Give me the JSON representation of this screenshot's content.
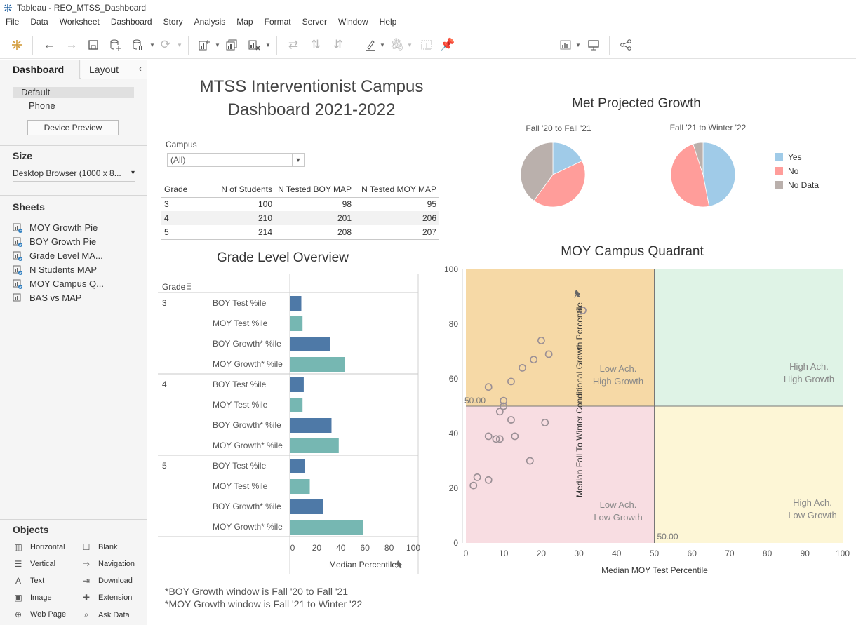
{
  "window": {
    "title": "Tableau - REO_MTSS_Dashboard"
  },
  "menu": [
    "File",
    "Data",
    "Worksheet",
    "Dashboard",
    "Story",
    "Analysis",
    "Map",
    "Format",
    "Server",
    "Window",
    "Help"
  ],
  "sidebar": {
    "tab_dashboard": "Dashboard",
    "tab_layout": "Layout",
    "device_default": "Default",
    "device_phone": "Phone",
    "device_preview": "Device Preview",
    "size_header": "Size",
    "size_value": "Desktop Browser (1000 x 8...",
    "sheets_header": "Sheets",
    "sheets": [
      "MOY Growth Pie",
      "BOY Growth Pie",
      "Grade Level MA...",
      "N Students MAP",
      "MOY Campus Q...",
      "BAS vs MAP"
    ],
    "objects_header": "Objects",
    "objects": [
      "Horizontal",
      "Blank",
      "Vertical",
      "Navigation",
      "Text",
      "Download",
      "Image",
      "Extension",
      "Web Page",
      "Ask Data"
    ]
  },
  "dashboard": {
    "title_line1": "MTSS Interventionist Campus",
    "title_line2": "Dashboard 2021-2022",
    "campus_label": "Campus",
    "campus_value": "(All)",
    "table": {
      "headers": [
        "Grade",
        "N of Students",
        "N Tested BOY MAP",
        "N Tested MOY MAP"
      ],
      "rows": [
        [
          "3",
          "100",
          "98",
          "95"
        ],
        [
          "4",
          "210",
          "201",
          "206"
        ],
        [
          "5",
          "214",
          "208",
          "207"
        ]
      ]
    },
    "growth_title": "Met Projected Growth",
    "pie1_label": "Fall '20 to Fall '21",
    "pie2_label": "Fall '21 to Winter '22",
    "legend": [
      {
        "label": "Yes",
        "color": "#a0cbe8"
      },
      {
        "label": "No",
        "color": "#ff9d9a"
      },
      {
        "label": "No Data",
        "color": "#bab0ac"
      }
    ],
    "grade_overview_title": "Grade Level Overview",
    "grade_col_header": "Grade",
    "bar_axis_title": "Median Percentile",
    "quadrant_title": "MOY Campus Quadrant",
    "quadrant_x_title": "Median MOY Test Percentile",
    "quadrant_y_title": "Median Fall To Winter Conditional Growth Percentile",
    "quadrant_labels": {
      "tl": [
        "Low Ach.",
        "High Growth"
      ],
      "tr": [
        "High Ach.",
        "High Growth"
      ],
      "bl": [
        "Low Ach.",
        "Low Growth"
      ],
      "br": [
        "High Ach.",
        "Low Growth"
      ]
    },
    "ref_line_label_y": "50.00",
    "ref_line_label_x": "50.00",
    "footnote1": "*BOY Growth window is Fall '20 to Fall '21",
    "footnote2": "*MOY Growth window is Fall '21 to Winter '22"
  },
  "chart_data": [
    {
      "type": "pie",
      "title": "Fall '20 to Fall '21",
      "categories": [
        "Yes",
        "No",
        "No Data"
      ],
      "values": [
        18,
        42,
        40
      ]
    },
    {
      "type": "pie",
      "title": "Fall '21 to Winter '22",
      "categories": [
        "Yes",
        "No",
        "No Data"
      ],
      "values": [
        47,
        48,
        5
      ]
    },
    {
      "type": "bar",
      "title": "Grade Level Overview",
      "xlabel": "Median Percentile",
      "xlim": [
        0,
        100
      ],
      "ticks": [
        0,
        20,
        40,
        60,
        80,
        100
      ],
      "groups": [
        {
          "grade": "3",
          "bars": [
            {
              "label": "BOY Test %ile",
              "value": 9
            },
            {
              "label": "MOY Test %ile",
              "value": 10
            },
            {
              "label": "BOY Growth* %ile",
              "value": 33
            },
            {
              "label": "MOY Growth* %ile",
              "value": 45
            }
          ]
        },
        {
          "grade": "4",
          "bars": [
            {
              "label": "BOY Test %ile",
              "value": 11
            },
            {
              "label": "MOY Test %ile",
              "value": 10
            },
            {
              "label": "BOY Growth* %ile",
              "value": 34
            },
            {
              "label": "MOY Growth* %ile",
              "value": 40
            }
          ]
        },
        {
          "grade": "5",
          "bars": [
            {
              "label": "BOY Test %ile",
              "value": 12
            },
            {
              "label": "MOY Test %ile",
              "value": 16
            },
            {
              "label": "BOY Growth* %ile",
              "value": 27
            },
            {
              "label": "MOY Growth* %ile",
              "value": 60
            }
          ]
        }
      ],
      "colors": {
        "BOY": "#4e79a7",
        "MOY": "#76b7b2"
      }
    },
    {
      "type": "scatter",
      "title": "MOY Campus Quadrant",
      "xlabel": "Median MOY Test Percentile",
      "ylabel": "Median Fall To Winter Conditional Growth Percentile",
      "xlim": [
        0,
        100
      ],
      "ylim": [
        0,
        100
      ],
      "xticks": [
        0,
        10,
        20,
        30,
        40,
        50,
        60,
        70,
        80,
        90,
        100
      ],
      "yticks": [
        0,
        20,
        40,
        60,
        80,
        100
      ],
      "reference": {
        "x": 50,
        "y": 50
      },
      "points": [
        [
          31,
          85
        ],
        [
          20,
          74
        ],
        [
          22,
          69
        ],
        [
          18,
          67
        ],
        [
          15,
          64
        ],
        [
          12,
          59
        ],
        [
          6,
          57
        ],
        [
          10,
          52
        ],
        [
          10,
          50
        ],
        [
          9,
          48
        ],
        [
          12,
          45
        ],
        [
          21,
          44
        ],
        [
          6,
          39
        ],
        [
          8,
          38
        ],
        [
          9,
          38
        ],
        [
          13,
          39
        ],
        [
          17,
          30
        ],
        [
          3,
          24
        ],
        [
          6,
          23
        ],
        [
          2,
          21
        ]
      ],
      "quadrant_colors": {
        "tl": "#f6d9a6",
        "tr": "#dff3e6",
        "bl": "#f8dde2",
        "br": "#fdf6d6"
      }
    }
  ]
}
